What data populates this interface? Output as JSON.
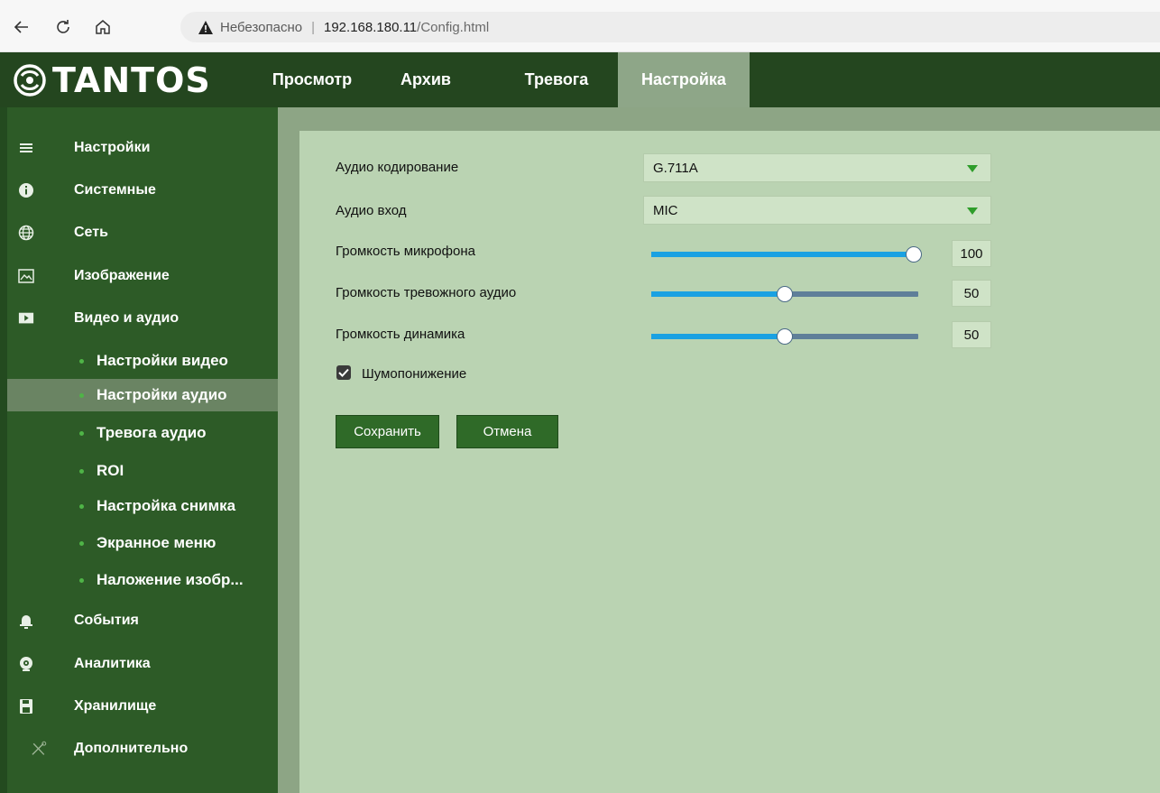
{
  "browser": {
    "security_label": "Небезопасно",
    "separator": "|",
    "host": "192.168.180.11",
    "path": "/Config.html"
  },
  "app": {
    "brand": "TANTOS",
    "tabs": [
      "Просмотр",
      "Архив",
      "Тревога",
      "Настройка"
    ],
    "active_tab": "Настройка"
  },
  "sidebar": {
    "items": [
      {
        "label": "Настройки",
        "icon": "list-icon"
      },
      {
        "label": "Системные",
        "icon": "info-icon"
      },
      {
        "label": "Сеть",
        "icon": "globe-icon"
      },
      {
        "label": "Изображение",
        "icon": "image-icon"
      },
      {
        "label": "Видео и аудио",
        "icon": "play-icon"
      }
    ],
    "subitems": [
      "Настройки видео",
      "Настройки аудио",
      "Тревога аудио",
      "ROI",
      "Настройка снимка",
      "Экранное меню",
      "Наложение изобр..."
    ],
    "active_subitem": "Настройки аудио",
    "bottom_items": [
      {
        "label": "События",
        "icon": "bell-icon"
      },
      {
        "label": "Аналитика",
        "icon": "camera-lens-icon"
      },
      {
        "label": "Хранилище",
        "icon": "floppy-icon"
      },
      {
        "label": "Дополнительно",
        "icon": "tools-icon"
      }
    ]
  },
  "form": {
    "audio_encoding": {
      "label": "Аудио кодирование",
      "value": "G.711A"
    },
    "audio_input": {
      "label": "Аудио вход",
      "value": "MIC"
    },
    "mic_volume": {
      "label": "Громкость микрофона",
      "value": 100
    },
    "alarm_audio_volume": {
      "label": "Громкость тревожного аудио",
      "value": 50
    },
    "speaker_volume": {
      "label": "Громкость динамика",
      "value": 50
    },
    "noise_reduction": {
      "label": "Шумопонижение",
      "checked": true
    },
    "save_label": "Сохранить",
    "cancel_label": "Отмена"
  },
  "colors": {
    "header": "#24461f",
    "sidebar": "#2d5b27",
    "active_tab": "#8ea688",
    "panel": "#bad3b2",
    "slider_fill": "#1aa1e2",
    "slider_track": "#5f7f99",
    "button": "#2f6a28"
  }
}
